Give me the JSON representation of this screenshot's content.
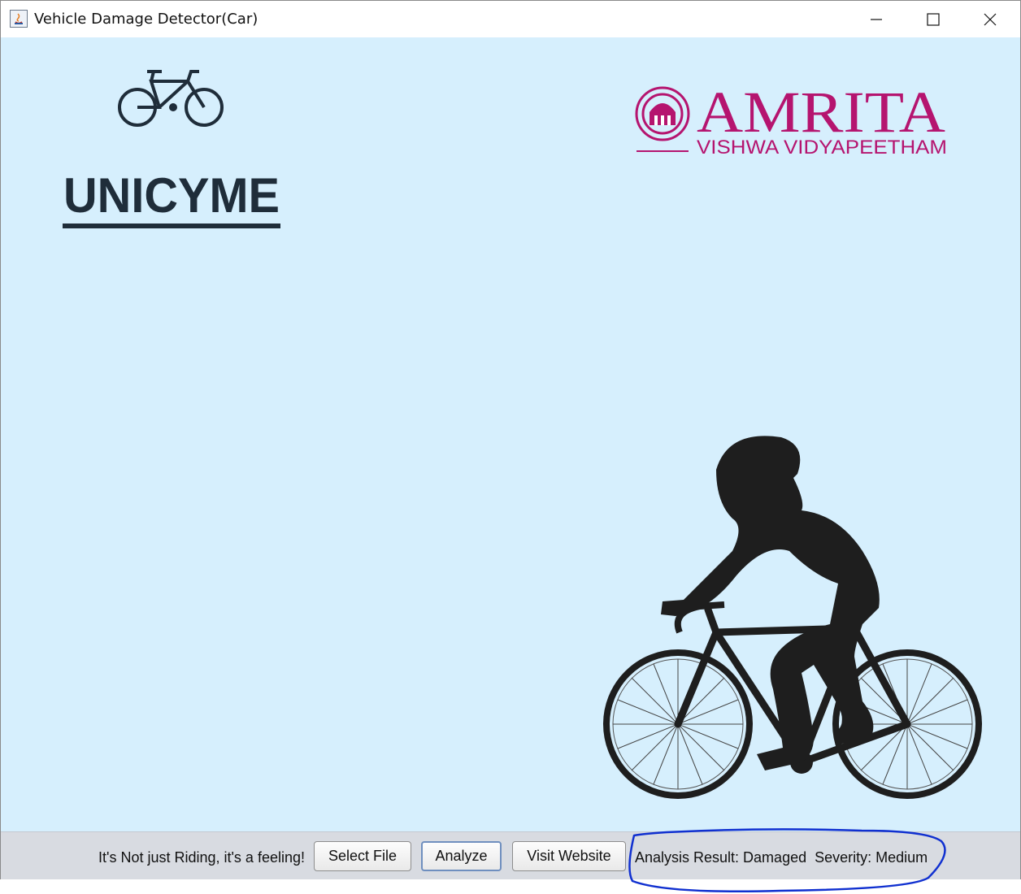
{
  "window": {
    "title": "Vehicle Damage Detector(Car)",
    "controls": [
      "minimize",
      "maximize",
      "close"
    ]
  },
  "logos": {
    "unicyme": "UNICYME",
    "amrita_main": "AMRITA",
    "amrita_sub": "VISHWA VIDYAPEETHAM"
  },
  "bottom_bar": {
    "tagline": "It's Not just Riding, it's a feeling!",
    "select_file_label": "Select File",
    "analyze_label": "Analyze",
    "visit_website_label": "Visit Website",
    "result_text": "Analysis Result: Damaged  Severity: Medium"
  },
  "colors": {
    "content_background": "#d6effd",
    "amrita_magenta": "#b5146f",
    "unicyme_dark": "#1f2d3a",
    "annotation_blue": "#1030d0"
  },
  "icons": [
    "java-app-icon",
    "minimize-icon",
    "maximize-icon",
    "close-icon",
    "bicycle-icon",
    "amrita-emblem-icon",
    "cyclist-silhouette"
  ]
}
